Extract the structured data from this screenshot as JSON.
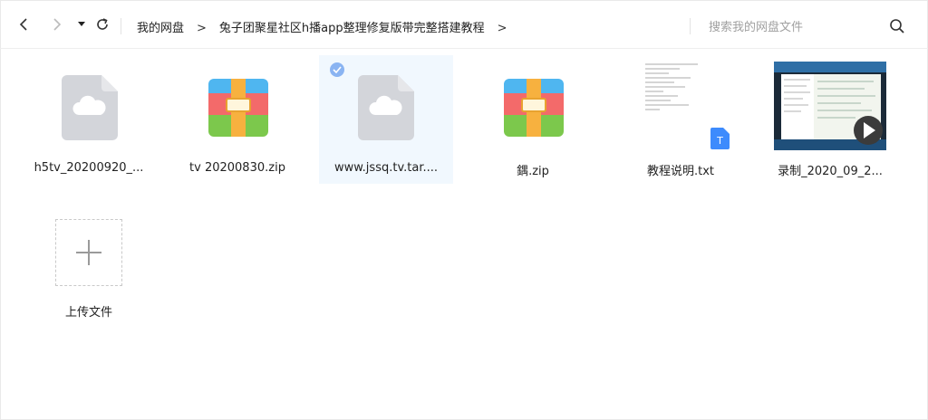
{
  "toolbar": {
    "back_icon": "chevron-left-icon",
    "forward_icon": "chevron-right-icon",
    "history_icon": "caret-down-icon",
    "refresh_icon": "refresh-icon",
    "breadcrumb": [
      "我的网盘",
      "兔子团聚星社区h播app整理修复版带完整搭建教程"
    ],
    "separator": ">",
    "search_placeholder": "搜索我的网盘文件",
    "search_icon": "search-icon"
  },
  "files": [
    {
      "name": "h5tv_20200920_...",
      "type": "cloud",
      "selected": false
    },
    {
      "name": "tv 20200830.zip",
      "type": "zip",
      "selected": false
    },
    {
      "name": "www.jssq.tv.tar....",
      "type": "cloud",
      "selected": true
    },
    {
      "name": "鍝.zip",
      "type": "zip",
      "selected": false
    },
    {
      "name": "教程说明.txt",
      "type": "txt",
      "selected": false
    },
    {
      "name": "录制_2020_09_2...",
      "type": "video",
      "selected": false
    }
  ],
  "upload": {
    "label": "上传文件",
    "icon": "plus-icon"
  },
  "colors": {
    "selected_bg": "#f1f8fe",
    "check_blue": "#8ab4f2",
    "zip_top": "#4fb6f0",
    "zip_mid": "#f36a6a",
    "zip_bottom": "#7cc84c",
    "zip_strap": "#f7b13f",
    "cloud_file": "#d3d5da",
    "txt_badge": "#3d8bfd"
  }
}
